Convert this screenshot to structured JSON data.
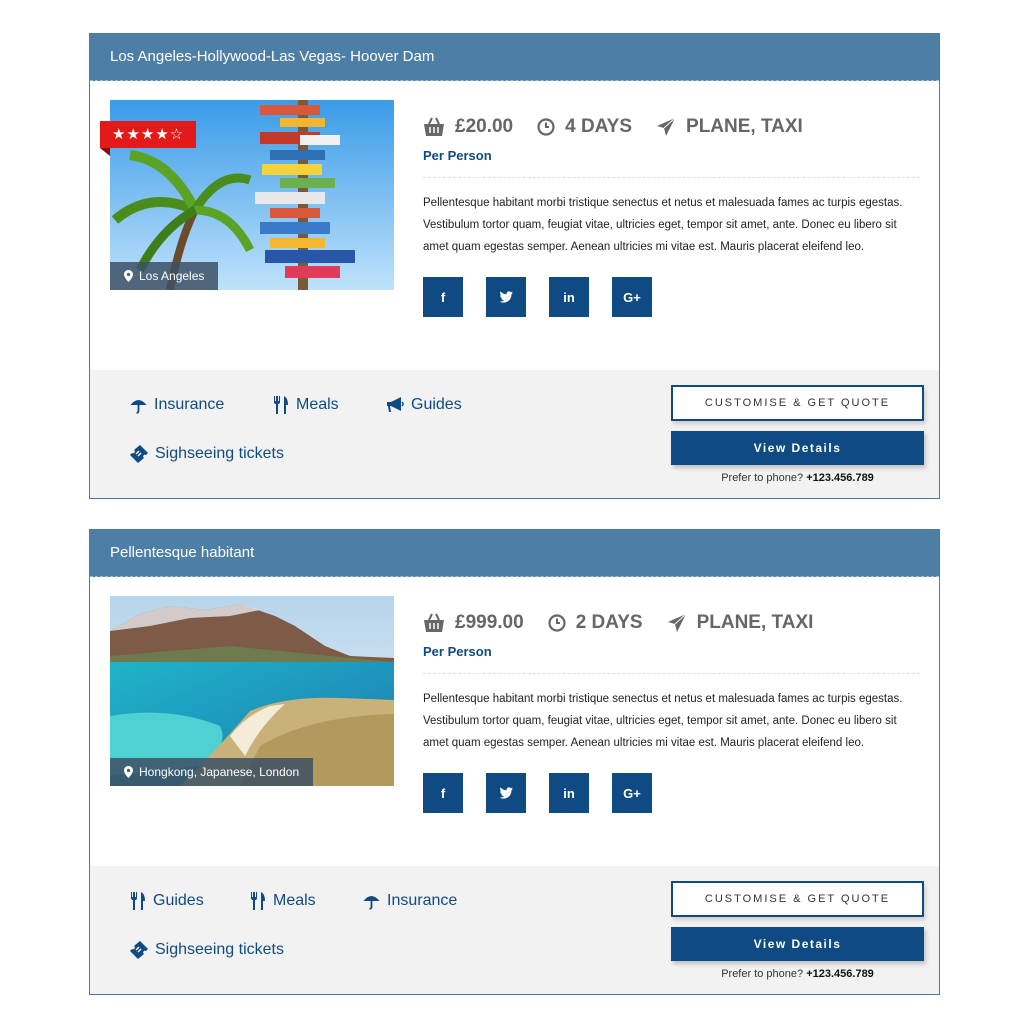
{
  "tours": [
    {
      "title": "Los Angeles-Hollywood-Las Vegas- Hoover Dam",
      "rating": {
        "value": 4,
        "max": 5,
        "stars_text": "★★★★☆"
      },
      "location": "Los Angeles",
      "price": "£20.00",
      "duration": "4 DAYS",
      "transport": "PLANE, TAXI",
      "price_note": "Per Person",
      "description": "Pellentesque habitant morbi tristique senectus et netus et malesuada fames ac turpis egestas. Vestibulum tortor quam, feugiat vitae, ultricies eget, tempor sit amet, ante. Donec eu libero sit amet quam egestas semper. Aenean ultricies mi vitae est. Mauris placerat eleifend leo.",
      "social": [
        "f",
        "t",
        "in",
        "G+"
      ],
      "features": [
        "Insurance",
        "Meals",
        "Guides",
        "Sighseeing tickets"
      ],
      "quote_label": "CUSTOMISE & GET QUOTE",
      "details_label": "View Details",
      "phone_prefix": "Prefer to phone?",
      "phone_number": "+123.456.789"
    },
    {
      "title": "Pellentesque habitant",
      "location": "Hongkong, Japanese, London",
      "price": "£999.00",
      "duration": "2 DAYS",
      "transport": "PLANE, TAXI",
      "price_note": "Per Person",
      "description": "Pellentesque habitant morbi tristique senectus et netus et malesuada fames ac turpis egestas. Vestibulum tortor quam, feugiat vitae, ultricies eget, tempor sit amet, ante. Donec eu libero sit amet quam egestas semper. Aenean ultricies mi vitae est. Mauris placerat eleifend leo.",
      "social": [
        "f",
        "t",
        "in",
        "G+"
      ],
      "features": [
        "Guides",
        "Meals",
        "Insurance",
        "Sighseeing tickets"
      ],
      "quote_label": "CUSTOMISE & GET QUOTE",
      "details_label": "View Details",
      "phone_prefix": "Prefer to phone?",
      "phone_number": "+123.456.789"
    }
  ],
  "icons": {
    "price": "basket-icon",
    "duration": "clock-icon",
    "transport": "paper-plane-icon",
    "location": "map-marker-icon",
    "Insurance": "umbrella-icon",
    "Meals": "cutlery-icon",
    "Guides": "bullhorn-icon",
    "Sighseeing tickets": "ticket-icon"
  },
  "colors": {
    "header_bg": "#4c7ea6",
    "primary": "#0f4a82",
    "rating_badge": "#e21a1a",
    "footer_bg": "#f2f2f2"
  }
}
